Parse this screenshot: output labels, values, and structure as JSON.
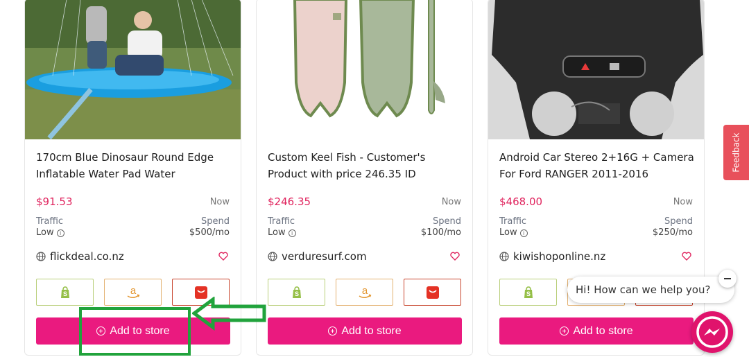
{
  "products": [
    {
      "title": "170cm Blue Dinosaur Round Edge Inflatable Water Pad Water",
      "price": "$91.53",
      "time": "Now",
      "traffic_label": "Traffic",
      "traffic_value": "Low",
      "spend_label": "Spend",
      "spend_value": "$500/mo",
      "site": "flickdeal.co.nz",
      "add_label": "Add to store"
    },
    {
      "title": "Custom Keel Fish - Customer's Product with price 246.35 ID",
      "price": "$246.35",
      "time": "Now",
      "traffic_label": "Traffic",
      "traffic_value": "Low",
      "spend_label": "Spend",
      "spend_value": "$100/mo",
      "site": "verduresurf.com",
      "add_label": "Add to store"
    },
    {
      "title": "Android Car Stereo 2+16G + Camera For Ford RANGER 2011-2016",
      "price": "$468.00",
      "time": "Now",
      "traffic_label": "Traffic",
      "traffic_value": "Low",
      "spend_label": "Spend",
      "spend_value": "$250/mo",
      "site": "kiwishoponline.nz",
      "add_label": "Add to store"
    }
  ],
  "feedback_label": "Feedback",
  "chat": {
    "greeting": "Hi! How can we help you?"
  },
  "icons": {
    "site": "globe-icon",
    "favorite": "heart-icon",
    "platforms": [
      "shopify-icon",
      "amazon-icon",
      "aliexpress-icon"
    ],
    "add": "plus-circle-icon",
    "chat_close": "minus-icon",
    "chat_launcher": "messenger-icon"
  },
  "colors": {
    "accent": "#ea1a7f",
    "price": "#e0245e",
    "feedback": "#e8505b",
    "annotation": "#21a33c"
  }
}
